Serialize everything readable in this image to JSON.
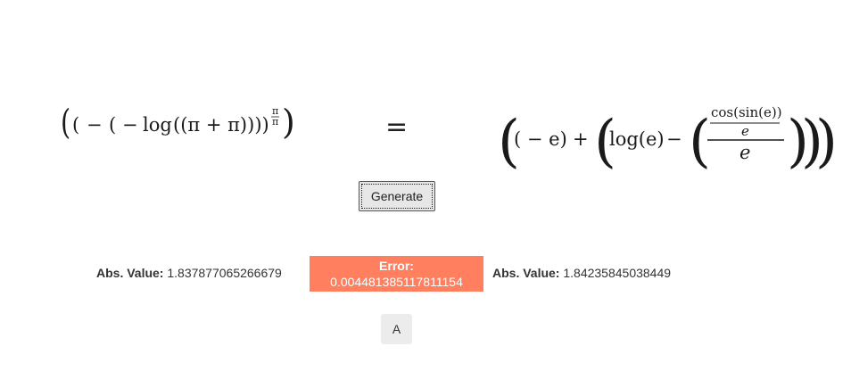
{
  "equation": {
    "lhs": {
      "open_outer": "(",
      "open_2": "(",
      "minus_1": "−",
      "open_3": "(",
      "minus_2": "−",
      "log": "log",
      "inner": "((π + π))))",
      "exp_num": "π",
      "exp_den": "π",
      "close_outer": ")"
    },
    "equals": "=",
    "rhs": {
      "paren_l1": "(",
      "neg_e": "( − e)",
      "plus": "+",
      "paren_l2": "(",
      "log_e": "log(e)",
      "minus": "−",
      "paren_l3": "(",
      "inner_num": "cos(sin(e))",
      "inner_den": "e",
      "outer_den": "e",
      "paren_r3": ")",
      "paren_r2": ")",
      "paren_r1": ")"
    }
  },
  "buttons": {
    "generate_label": "Generate",
    "a_label": "A"
  },
  "results": {
    "abs_label": "Abs. Value:",
    "left_value": "1.837877065266679",
    "right_value": "1.84235845038449",
    "error_label": "Error:",
    "error_value": "0.004481385117811154"
  },
  "colors": {
    "error_background": "#ff7f5f",
    "button_background": "#e7e7e7"
  }
}
